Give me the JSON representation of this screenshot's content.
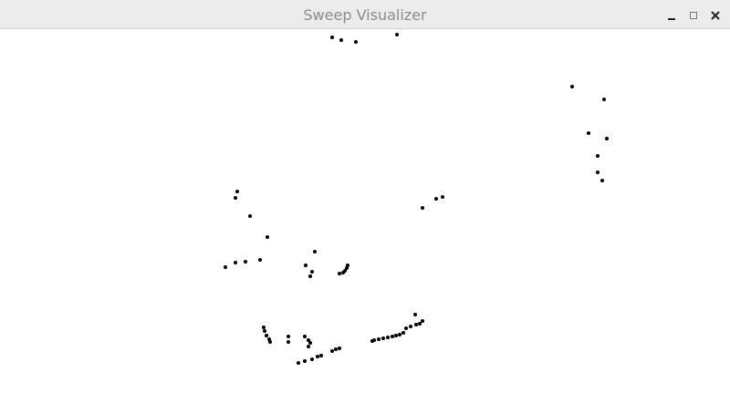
{
  "window": {
    "title": "Sweep Visualizer"
  },
  "controls": {
    "minimize_icon": "minimize-icon",
    "maximize_icon": "maximize-icon",
    "close_icon": "close-icon"
  },
  "plot": {
    "point_color": "#000000",
    "background": "#ffffff"
  }
}
